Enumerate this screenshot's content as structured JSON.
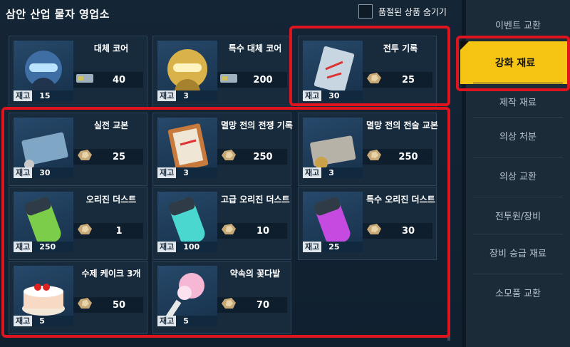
{
  "header": {
    "title": "삼안 산업 물자 영업소",
    "hide_soldout_label": "품절된 상품 숨기기"
  },
  "stock_label": "재고",
  "items": [
    {
      "name": "대체 코어",
      "stock": "15",
      "price": "40",
      "currency": "credit-card",
      "thumb": "android-portrait-icon"
    },
    {
      "name": "특수 대체 코어",
      "stock": "3",
      "price": "200",
      "currency": "credit-card",
      "thumb": "golden-android-portrait-icon"
    },
    {
      "name": "전투 기록",
      "stock": "30",
      "price": "25",
      "currency": "ore",
      "thumb": "battle-record-icon"
    },
    {
      "name": "실전 교본",
      "stock": "30",
      "price": "25",
      "currency": "ore",
      "thumb": "combat-manual-icon"
    },
    {
      "name": "멸망 전의 전쟁 기록",
      "stock": "3",
      "price": "250",
      "currency": "ore",
      "thumb": "war-record-icon"
    },
    {
      "name": "멸망 전의 전술 교본",
      "stock": "3",
      "price": "250",
      "currency": "ore",
      "thumb": "tactics-manual-icon"
    },
    {
      "name": "오리진 더스트",
      "stock": "250",
      "price": "1",
      "currency": "ore",
      "thumb": "green-dust-capsule-icon"
    },
    {
      "name": "고급 오리진 더스트",
      "stock": "100",
      "price": "10",
      "currency": "ore",
      "thumb": "cyan-dust-capsule-icon"
    },
    {
      "name": "특수 오리진 더스트",
      "stock": "25",
      "price": "30",
      "currency": "ore",
      "thumb": "purple-dust-capsule-icon"
    },
    {
      "name": "수제 케이크 3개",
      "stock": "5",
      "price": "50",
      "currency": "ore",
      "thumb": "cake-icon"
    },
    {
      "name": "약속의 꽃다발",
      "stock": "5",
      "price": "70",
      "currency": "ore",
      "thumb": "bouquet-icon"
    }
  ],
  "sidebar": {
    "items": [
      {
        "label": "이벤트 교환",
        "active": false
      },
      {
        "label": "강화 재료",
        "active": true
      },
      {
        "label": "제작 재료",
        "active": false
      },
      {
        "label": "의상 처분",
        "active": false
      },
      {
        "label": "의상 교환",
        "active": false
      },
      {
        "label": "전투원/장비",
        "active": false
      },
      {
        "label": "장비 승급 재료",
        "active": false
      },
      {
        "label": "소모품 교환",
        "active": false
      }
    ]
  },
  "colors": {
    "highlight": "#e0141e",
    "active_tab": "#f6c514",
    "card_bg": "#182b3d"
  }
}
